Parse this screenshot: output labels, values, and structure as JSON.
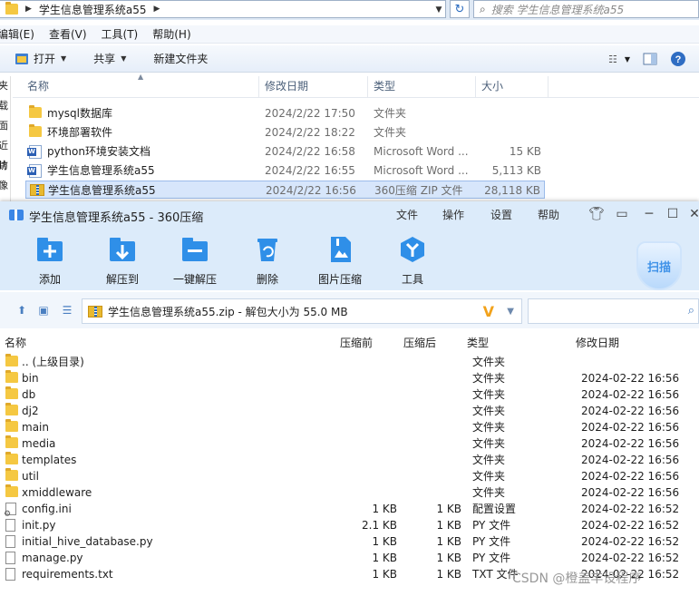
{
  "explorer": {
    "breadcrumb": "学生信息管理系统a55",
    "search_placeholder": "搜索 学生信息管理系统a55",
    "menu": [
      "编辑(E)",
      "查看(V)",
      "工具(T)",
      "帮助(H)"
    ],
    "commands": {
      "open": "打开",
      "share": "共享",
      "new_folder": "新建文件夹"
    },
    "nav_pane_chars": [
      "夹",
      "载",
      "面",
      "近访",
      "片",
      "像",
      "档",
      "乐"
    ],
    "columns": {
      "name": "名称",
      "date": "修改日期",
      "type": "类型",
      "size": "大小"
    },
    "files": [
      {
        "icon": "folder-icon",
        "name": "mysql数据库",
        "date": "2024/2/22 17:50",
        "type": "文件夹",
        "size": ""
      },
      {
        "icon": "folder-icon",
        "name": "环境部署软件",
        "date": "2024/2/22 18:22",
        "type": "文件夹",
        "size": ""
      },
      {
        "icon": "word-doc-icon",
        "name": "python环境安装文档",
        "date": "2024/2/22 16:58",
        "type": "Microsoft Word ...",
        "size": "15 KB"
      },
      {
        "icon": "word-doc-icon",
        "name": "学生信息管理系统a55",
        "date": "2024/2/22 16:55",
        "type": "Microsoft Word ...",
        "size": "5,113 KB"
      },
      {
        "icon": "zip-archive-icon",
        "name": "学生信息管理系统a55",
        "date": "2024/2/22 16:56",
        "type": "360压缩 ZIP 文件",
        "size": "28,118 KB",
        "selected": true
      }
    ]
  },
  "zip": {
    "title": "学生信息管理系统a55 - 360压缩",
    "title_menu": [
      "文件",
      "操作",
      "设置",
      "帮助"
    ],
    "tools": [
      {
        "icon": "add-icon",
        "label": "添加"
      },
      {
        "icon": "extract-to-icon",
        "label": "解压到"
      },
      {
        "icon": "one-click-extract-icon",
        "label": "一键解压"
      },
      {
        "icon": "delete-icon",
        "label": "删除"
      },
      {
        "icon": "image-compress-icon",
        "label": "图片压缩"
      },
      {
        "icon": "tools-icon",
        "label": "工具"
      }
    ],
    "scan_label": "扫描",
    "path": "学生信息管理系统a55.zip - 解包大小为 55.0 MB",
    "columns": {
      "name": "名称",
      "before": "压缩前",
      "after": "压缩后",
      "type": "类型",
      "modified": "修改日期"
    },
    "entries": [
      {
        "icon": "folder-icon",
        "name": ".. (上级目录)",
        "before": "",
        "after": "",
        "type": "文件夹",
        "modified": ""
      },
      {
        "icon": "folder-icon",
        "name": "bin",
        "before": "",
        "after": "",
        "type": "文件夹",
        "modified": "2024-02-22 16:56"
      },
      {
        "icon": "folder-icon",
        "name": "db",
        "before": "",
        "after": "",
        "type": "文件夹",
        "modified": "2024-02-22 16:56"
      },
      {
        "icon": "folder-icon",
        "name": "dj2",
        "before": "",
        "after": "",
        "type": "文件夹",
        "modified": "2024-02-22 16:56"
      },
      {
        "icon": "folder-icon",
        "name": "main",
        "before": "",
        "after": "",
        "type": "文件夹",
        "modified": "2024-02-22 16:56"
      },
      {
        "icon": "folder-icon",
        "name": "media",
        "before": "",
        "after": "",
        "type": "文件夹",
        "modified": "2024-02-22 16:56"
      },
      {
        "icon": "folder-icon",
        "name": "templates",
        "before": "",
        "after": "",
        "type": "文件夹",
        "modified": "2024-02-22 16:56"
      },
      {
        "icon": "folder-icon",
        "name": "util",
        "before": "",
        "after": "",
        "type": "文件夹",
        "modified": "2024-02-22 16:56"
      },
      {
        "icon": "folder-icon",
        "name": "xmiddleware",
        "before": "",
        "after": "",
        "type": "文件夹",
        "modified": "2024-02-22 16:56"
      },
      {
        "icon": "config-file-icon",
        "name": "config.ini",
        "before": "1 KB",
        "after": "1 KB",
        "type": "配置设置",
        "modified": "2024-02-22 16:52"
      },
      {
        "icon": "file-icon",
        "name": "init.py",
        "before": "2.1 KB",
        "after": "1 KB",
        "type": "PY 文件",
        "modified": "2024-02-22 16:52"
      },
      {
        "icon": "file-icon",
        "name": "initial_hive_database.py",
        "before": "1 KB",
        "after": "1 KB",
        "type": "PY 文件",
        "modified": "2024-02-22 16:52"
      },
      {
        "icon": "file-icon",
        "name": "manage.py",
        "before": "1 KB",
        "after": "1 KB",
        "type": "PY 文件",
        "modified": "2024-02-22 16:52"
      },
      {
        "icon": "file-icon",
        "name": "requirements.txt",
        "before": "1 KB",
        "after": "1 KB",
        "type": "TXT 文件",
        "modified": "2024-02-22 16:52"
      }
    ]
  },
  "watermark": "CSDN @橙盖丰设程序"
}
